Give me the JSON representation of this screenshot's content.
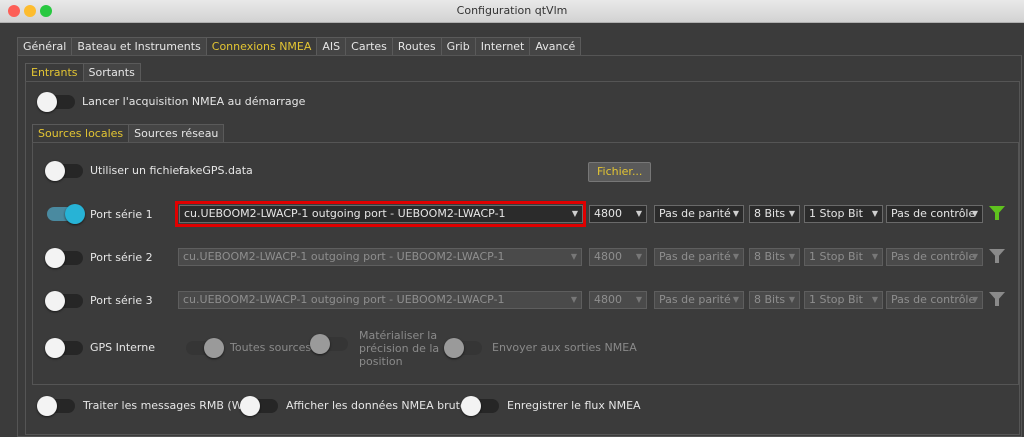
{
  "window": {
    "title": "Configuration qtVlm"
  },
  "main_tabs": [
    "Général",
    "Bateau et Instruments",
    "Connexions NMEA",
    "AIS",
    "Cartes",
    "Routes",
    "Grib",
    "Internet",
    "Avancé"
  ],
  "sub_tabs": [
    "Entrants",
    "Sortants"
  ],
  "startup_toggle_label": "Lancer l'acquisition NMEA au démarrage",
  "source_tabs": [
    "Sources locales",
    "Sources réseau"
  ],
  "file_source": {
    "label": "Utiliser un fichier",
    "filename": "fakeGPS.data",
    "button": "Fichier..."
  },
  "serial_ports": [
    {
      "label": "Port série 1",
      "port": "cu.UEBOOM2-LWACP-1 outgoing port - UEBOOM2-LWACP-1",
      "baud": "4800",
      "parity": "Pas de parité",
      "bits": "8 Bits",
      "stop": "1 Stop Bit",
      "control": "Pas de contrôle",
      "enabled": true
    },
    {
      "label": "Port série 2",
      "port": "cu.UEBOOM2-LWACP-1 outgoing port - UEBOOM2-LWACP-1",
      "baud": "4800",
      "parity": "Pas de parité",
      "bits": "8 Bits",
      "stop": "1 Stop Bit",
      "control": "Pas de contrôle",
      "enabled": false
    },
    {
      "label": "Port série 3",
      "port": "cu.UEBOOM2-LWACP-1 outgoing port - UEBOOM2-LWACP-1",
      "baud": "4800",
      "parity": "Pas de parité",
      "bits": "8 Bits",
      "stop": "1 Stop Bit",
      "control": "Pas de contrôle",
      "enabled": false
    }
  ],
  "gps_interne": {
    "label": "GPS Interne",
    "all_sources": "Toutes sources",
    "precision_line1": "Matérialiser la",
    "precision_line2": "précision de la",
    "precision_line3": "position",
    "send_outputs": "Envoyer aux sorties NMEA"
  },
  "bottom_options": [
    "Traiter les messages RMB (WP)",
    "Afficher les données NMEA brutes",
    "Enregistrer le flux NMEA"
  ],
  "colors": {
    "accent": "#e3c533",
    "toggle_on": "#27b3d6",
    "filter_active": "#5fc21e",
    "filter_inactive": "#8a8a8a",
    "highlight": "#e00000"
  },
  "icons": {
    "filter": "funnel-icon"
  }
}
